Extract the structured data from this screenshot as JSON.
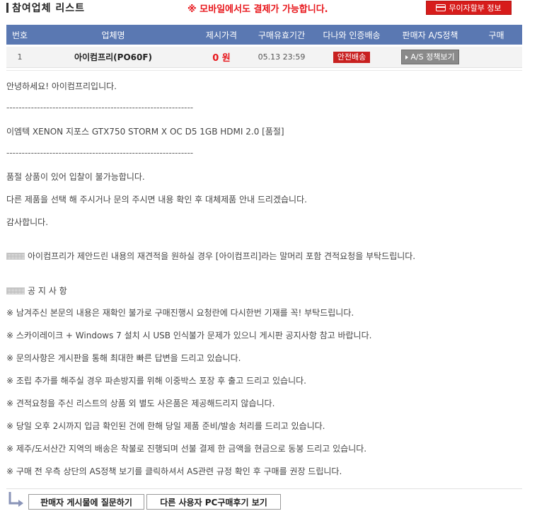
{
  "header": {
    "title": "참여업체 리스트",
    "mobile_notice": "※ 모바일에서도 결제가 가능합니다.",
    "installment_label": "무이자할부 정보",
    "installment_icon": "card-icon"
  },
  "table": {
    "columns": [
      "번호",
      "업체명",
      "제시가격",
      "구매유효기간",
      "다나와 인증배송",
      "판매자 A/S정책",
      "구매"
    ],
    "rows": [
      {
        "no": "1",
        "vendor": "아이컴프리(PO60F)",
        "price": "0 원",
        "valid_until": "05.13 23:59",
        "cert_badge": "안전배송",
        "as_button": "A/S 정책보기",
        "buy": ""
      }
    ]
  },
  "content": {
    "lines": [
      "안녕하세요! 아이컴프리입니다.",
      "-------------------------------------------------------------",
      "이엠텍 XENON 지포스 GTX750 STORM X OC D5 1GB HDMI 2.0 [품절]",
      "-------------------------------------------------------------",
      "품절 상품이 있어 입찰이 불가능합니다.",
      "다른 제품을 선택 해 주시거나 문의 주시면 내용 확인 후 대체제품 안내 드리겠습니다.",
      "감사합니다."
    ],
    "reestimate_notice": "아이컴프리가 제안드린 내용의 재견적을 원하실 경우 [아이컴프리]라는 말머리 포함 견적요청을 부탁드립니다.",
    "notice_heading": "공 지 사 항",
    "notices": [
      "※ 남겨주신 본문의 내용은 재확인 불가로 구매진행시 요청란에 다시한번 기재를 꼭! 부탁드립니다.",
      "※ 스카이레이크 + Windows 7 설치 시 USB 인식불가 문제가 있으니 게시판 공지사항 참고 바랍니다.",
      "※ 문의사항은 게시판을 통해 최대한 빠른 답변을 드리고 있습니다.",
      "※ 조립 추가를 해주실 경우 파손방지를 위해 이중박스 포장 후 출고 드리고 있습니다.",
      "※ 견적요청을 주신 리스트의 상품 외 별도 사은품은 제공해드리지 않습니다.",
      "※ 당일 오후 2시까지 입금 확인된 건에 한해 당일 제품 준비/발송 처리를 드리고 있습니다.",
      "※ 제주/도서산간 지역의 배송은 착불로 진행되며 선불 결제 한 금액을 현금으로 동봉 드리고 있습니다.",
      "※ 구매 전 우측 상단의 AS정책 보기를 클릭하셔서 AS관련 규정 확인 후 구매를 권장 드립니다."
    ]
  },
  "footer": {
    "ask_button": "판매자 게시물에 질문하기",
    "review_button": "다른 사용자 PC구매후기 보기",
    "arrow_icon": "return-arrow-icon"
  },
  "colors": {
    "header_bg": "#5a78b2",
    "accent_red": "#e8161b",
    "badge_red": "#c8201f"
  }
}
